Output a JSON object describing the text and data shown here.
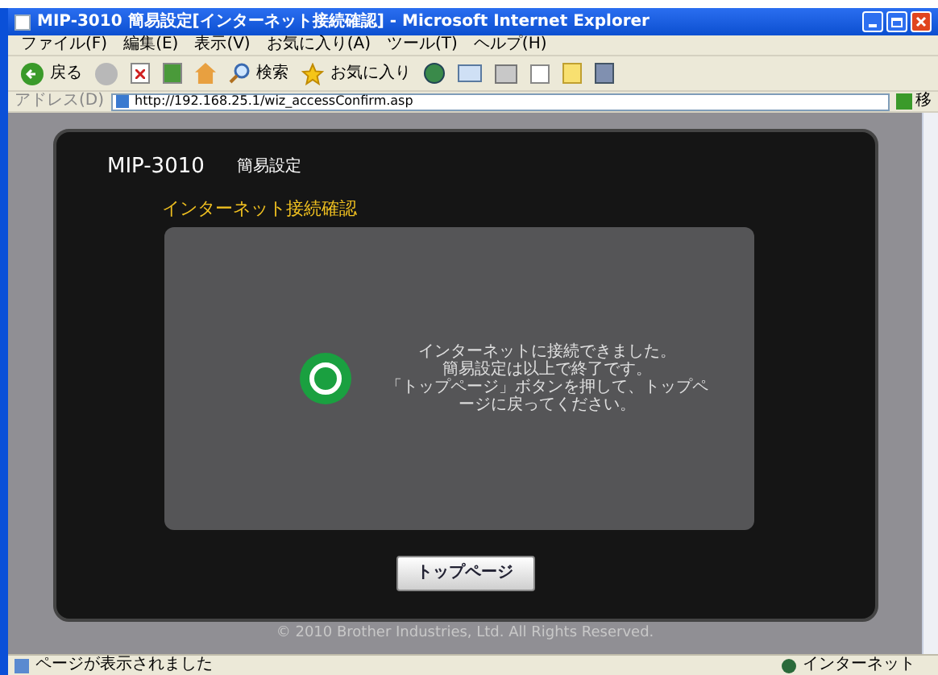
{
  "window": {
    "title": "MIP-3010 簡易設定[インターネット接続確認] - Microsoft Internet Explorer"
  },
  "menu": [
    "ファイル(F)",
    "編集(E)",
    "表示(V)",
    "お気に入り(A)",
    "ツール(T)",
    "ヘルプ(H)"
  ],
  "toolbar": {
    "back": "戻る",
    "search": "検索",
    "favorites": "お気に入り"
  },
  "address": {
    "label": "アドレス(D)",
    "url": "http://192.168.25.1/wiz_accessConfirm.asp",
    "go": "移"
  },
  "page": {
    "brand": "MIP-3010",
    "subtitle": "簡易設定",
    "heading": "インターネット接続確認",
    "message": [
      "インターネットに接続できました。",
      "簡易設定は以上で終了です。",
      "「トップページ」ボタンを押して、トップペ",
      "ージに戻ってください。"
    ],
    "button": "トップページ",
    "footer": "© 2010 Brother Industries, Ltd. All Rights Reserved."
  },
  "status_bar": {
    "text": "ページが表示されました",
    "zone": "インターネット"
  }
}
